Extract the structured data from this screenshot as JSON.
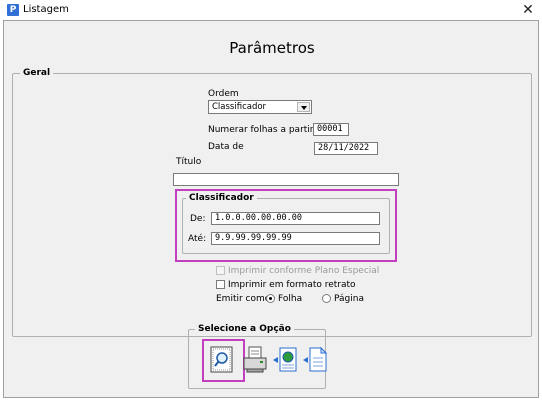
{
  "window": {
    "title": "Listagem",
    "app_icon": "P",
    "close_glyph": "✕"
  },
  "heading": "Parâmetros",
  "geral": {
    "legend": "Geral",
    "ordem_label": "Ordem",
    "ordem_value": "Classificador",
    "numerar_label": "Numerar folhas a partir de:",
    "numerar_value": "00001",
    "data_label": "Data de",
    "data_value": "28/11/2022",
    "titulo_label": "Título",
    "titulo_value": ""
  },
  "classificador": {
    "legend": "Classificador",
    "de_label": "De:",
    "de_value": "1.0.0.00.00.00.00",
    "ate_label": "Até:",
    "ate_value": "9.9.99.99.99.99"
  },
  "options": {
    "plano_especial_label": "Imprimir conforme Plano Especial",
    "plano_especial_enabled": false,
    "retrato_label": "Imprimir em formato retrato",
    "emitir_label": "Emitir como:",
    "folha_label": "Folha",
    "pagina_label": "Página",
    "emitir_selected": "Folha"
  },
  "selecione": {
    "legend": "Selecione a Opção",
    "buttons": [
      {
        "icon": "preview-magnifier-icon"
      },
      {
        "icon": "printer-icon"
      },
      {
        "icon": "export-document-icon"
      },
      {
        "icon": "export-file-icon"
      }
    ],
    "selected": "preview-magnifier-icon"
  },
  "colors": {
    "highlight": "#c040c0",
    "background": "#f0f0f0"
  }
}
